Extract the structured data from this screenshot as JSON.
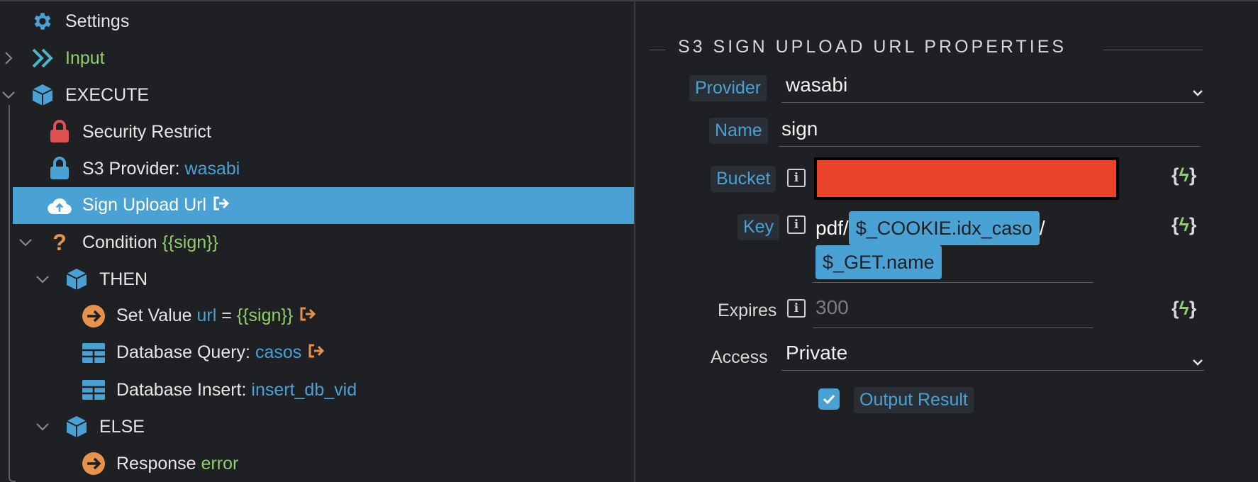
{
  "tree": {
    "settings": {
      "label": "Settings"
    },
    "input": {
      "label": "Input"
    },
    "execute": {
      "label": "EXECUTE"
    },
    "security": {
      "label": "Security Restrict"
    },
    "s3provider": {
      "label": "S3 Provider:",
      "value": "wasabi"
    },
    "sign_upload": {
      "label": "Sign Upload Url"
    },
    "condition": {
      "label": "Condition",
      "value": "{{sign}}"
    },
    "then": {
      "label": "THEN"
    },
    "set_value": {
      "label": "Set Value",
      "var": "url",
      "eq": "=",
      "value": "{{sign}}"
    },
    "db_query": {
      "label": "Database Query:",
      "value": "casos"
    },
    "db_insert": {
      "label": "Database Insert:",
      "value": "insert_db_vid"
    },
    "else": {
      "label": "ELSE"
    },
    "response": {
      "label": "Response",
      "value": "error"
    }
  },
  "props": {
    "title": "S3 SIGN UPLOAD URL PROPERTIES",
    "provider": {
      "label": "Provider",
      "value": "wasabi"
    },
    "name": {
      "label": "Name",
      "value": "sign"
    },
    "bucket": {
      "label": "Bucket"
    },
    "key": {
      "label": "Key",
      "prefix": "pdf/",
      "token1": "$_COOKIE.idx_caso",
      "sep": "/",
      "token2": "$_GET.name"
    },
    "expires": {
      "label": "Expires",
      "placeholder": "300"
    },
    "access": {
      "label": "Access",
      "value": "Private"
    },
    "output": {
      "label": "Output Result",
      "checked": true
    }
  },
  "colors": {
    "accent": "#4aa1d4",
    "green": "#8fcf6a",
    "orange": "#e8914c",
    "red": "#e8432a"
  }
}
